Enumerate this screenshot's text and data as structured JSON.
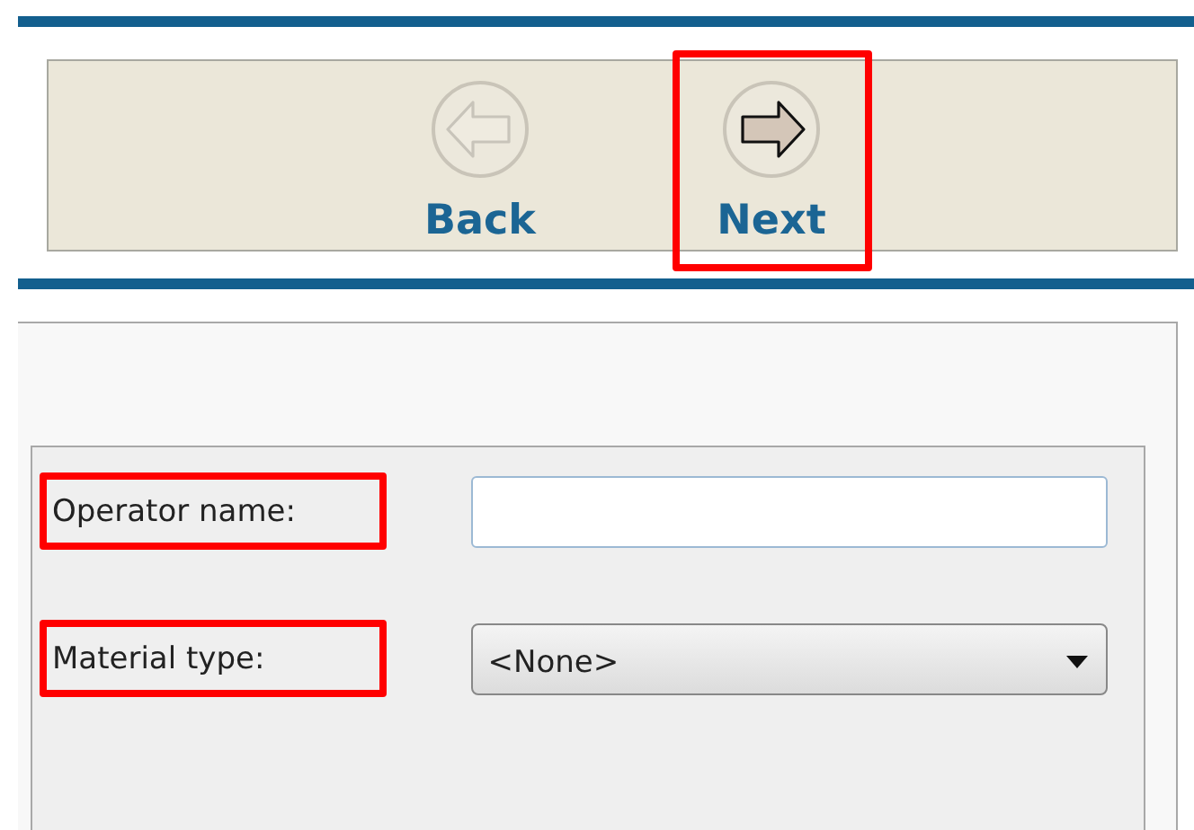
{
  "nav_buttons": [
    {
      "kind": "back",
      "label": "Back",
      "disabled": true,
      "highlighted": false
    },
    {
      "kind": "next",
      "label": "Next",
      "disabled": false,
      "highlighted": true
    }
  ],
  "fields": [
    {
      "kind": "text",
      "label": "Operator name:",
      "highlighted": true
    },
    {
      "kind": "select",
      "label": "Material type:",
      "value": "<None>",
      "highlighted": true
    }
  ]
}
